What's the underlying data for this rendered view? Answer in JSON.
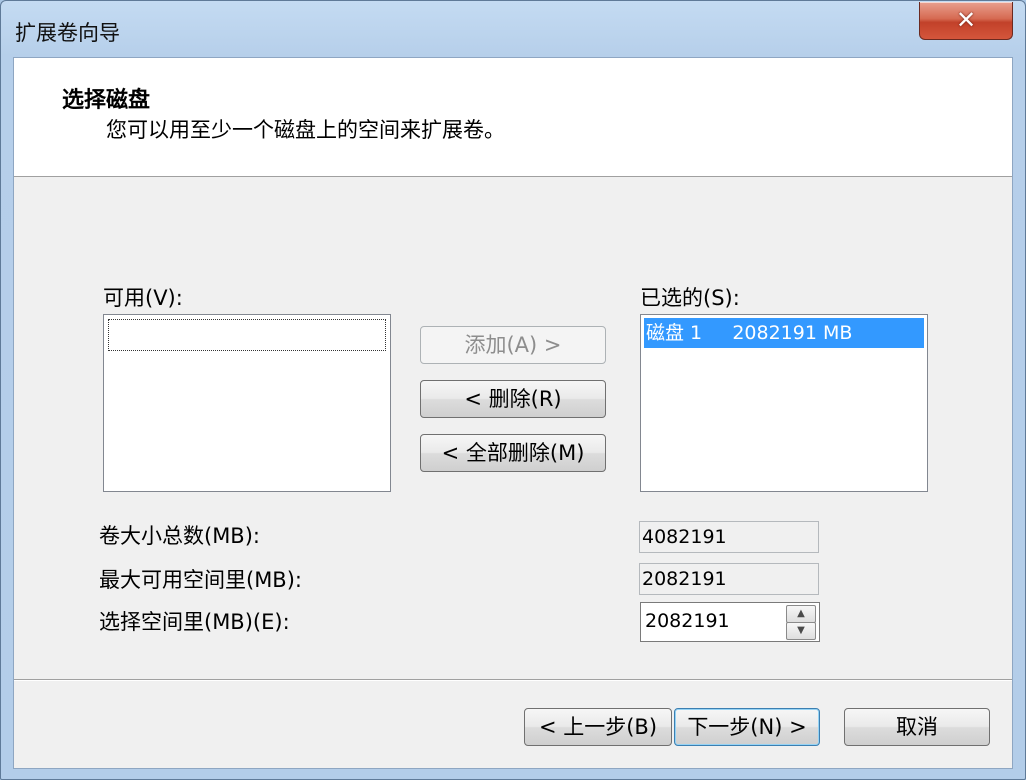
{
  "window": {
    "title": "扩展卷向导"
  },
  "header": {
    "title": "选择磁盘",
    "subtitle": "您可以用至少一个磁盘上的空间来扩展卷。"
  },
  "available": {
    "label": "可用(V):",
    "items": []
  },
  "selected": {
    "label": "已选的(S):",
    "items": [
      {
        "text": "磁盘 1     2082191 MB"
      }
    ]
  },
  "actions": {
    "add": "添加(A) >",
    "remove": "< 删除(R)",
    "remove_all": "< 全部删除(M)"
  },
  "fields": {
    "total_label": "卷大小总数(MB):",
    "total_value": "4082191",
    "max_label": "最大可用空间里(MB):",
    "max_value": "2082191",
    "select_label": "选择空间里(MB)(E):",
    "select_value": "2082191"
  },
  "footer": {
    "back": "< 上一步(B)",
    "next": "下一步(N) >",
    "cancel": "取消"
  },
  "icons": {
    "close": "close-icon",
    "spin_up": "spin-up-icon",
    "spin_down": "spin-down-icon"
  },
  "colors": {
    "selection": "#3399ff",
    "close_button": "#c2412a"
  }
}
